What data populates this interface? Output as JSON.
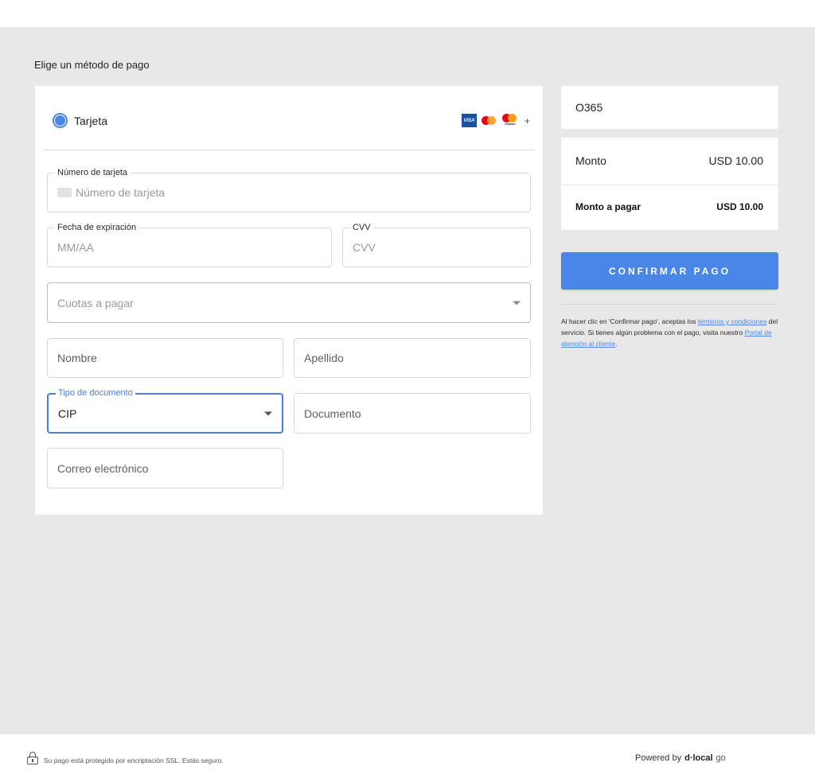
{
  "page": {
    "section_title": "Elige un método de pago"
  },
  "payment_method": {
    "label": "Tarjeta",
    "brands": [
      "visa-logo",
      "mastercard-logo",
      "maestro-logo"
    ],
    "visa_text": "VISA",
    "more": "+"
  },
  "form": {
    "card_number": {
      "legend": "Número de tarjeta",
      "placeholder": "Número de tarjeta"
    },
    "expiry": {
      "legend": "Fecha de expiración",
      "placeholder": "MM/AA"
    },
    "cvv": {
      "legend": "CVV",
      "placeholder": "CVV"
    },
    "installments": {
      "placeholder": "Cuotas a pagar"
    },
    "first_name": {
      "placeholder": "Nombre"
    },
    "last_name": {
      "placeholder": "Apellido"
    },
    "doc_type": {
      "legend": "Tipo de documento",
      "value": "CIP"
    },
    "document": {
      "placeholder": "Documento"
    },
    "email": {
      "placeholder": "Correo electrónico"
    }
  },
  "summary": {
    "code": "O365",
    "amount_label": "Monto",
    "amount_value": "USD 10.00",
    "total_label": "Monto a pagar",
    "total_value": "USD 10.00"
  },
  "confirm_button": "CONFIRMAR PAGO",
  "legal": {
    "prefix": "Al hacer clic en 'Confirmar pago', aceptas los ",
    "terms_link": "términos y condiciones",
    "middle": " del servicio. Si tienes algún problema con el pago, visita nuestro ",
    "portal_link": "Portal de atención al cliente",
    "suffix": "."
  },
  "footer": {
    "security_text": "Su pago está protegido por encriptación SSL. Estás seguro.",
    "powered_by": "Powered by",
    "brand": "d·local",
    "brand_suffix": "go"
  },
  "colors": {
    "accent": "#4a86e8",
    "background": "#e8e8e8"
  }
}
